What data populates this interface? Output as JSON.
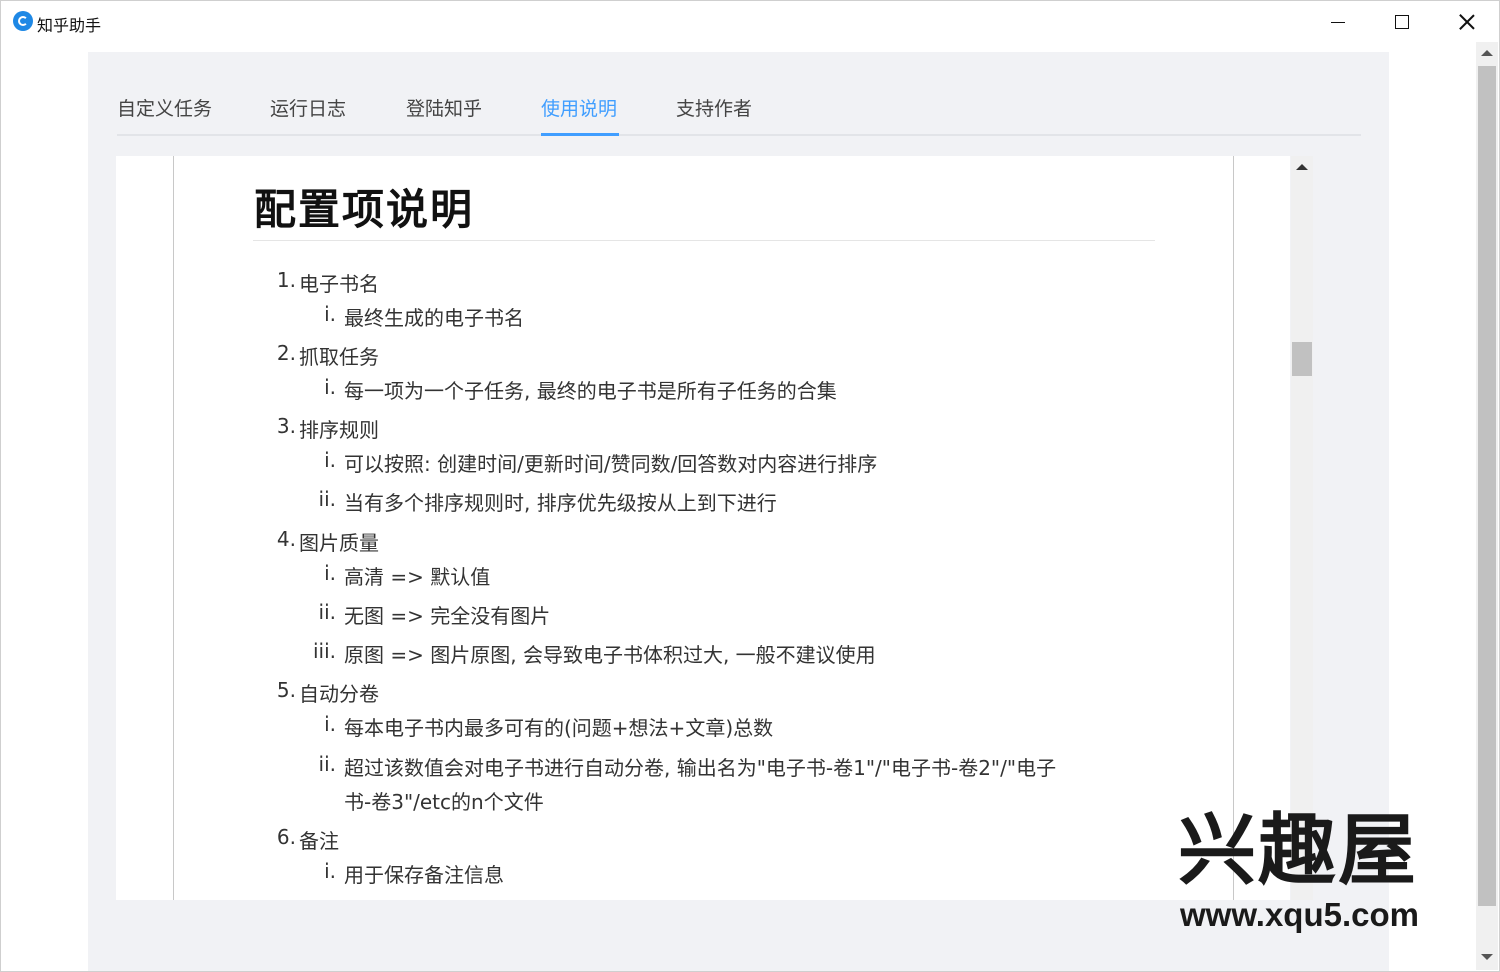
{
  "window": {
    "title": "知乎助手"
  },
  "tabs": [
    {
      "label": "自定义任务",
      "active": false
    },
    {
      "label": "运行日志",
      "active": false
    },
    {
      "label": "登陆知乎",
      "active": false
    },
    {
      "label": "使用说明",
      "active": true
    },
    {
      "label": "支持作者",
      "active": false
    }
  ],
  "colors": {
    "accent": "#409eff",
    "panel_bg": "#f1f2f5"
  },
  "doc": {
    "title": "配置项说明",
    "items": [
      {
        "num": "1.",
        "label": "电子书名",
        "subs": [
          {
            "num": "i.",
            "text": "最终生成的电子书名"
          }
        ]
      },
      {
        "num": "2.",
        "label": "抓取任务",
        "subs": [
          {
            "num": "i.",
            "text": "每一项为一个子任务, 最终的电子书是所有子任务的合集"
          }
        ]
      },
      {
        "num": "3.",
        "label": "排序规则",
        "subs": [
          {
            "num": "i.",
            "text": "可以按照: 创建时间/更新时间/赞同数/回答数对内容进行排序"
          },
          {
            "num": "ii.",
            "text": "当有多个排序规则时, 排序优先级按从上到下进行"
          }
        ]
      },
      {
        "num": "4.",
        "label": "图片质量",
        "subs": [
          {
            "num": "i.",
            "text": "高清 => 默认值"
          },
          {
            "num": "ii.",
            "text": "无图 => 完全没有图片"
          },
          {
            "num": "iii.",
            "text": "原图 => 图片原图, 会导致电子书体积过大, 一般不建议使用"
          }
        ]
      },
      {
        "num": "5.",
        "label": "自动分卷",
        "subs": [
          {
            "num": "i.",
            "text": "每本电子书内最多可有的(问题+想法+文章)总数"
          },
          {
            "num": "ii.",
            "text": "超过该数值会对电子书进行自动分卷, 输出名为\"电子书-卷1\"/\"电子书-卷2\"/\"电子",
            "cont": "书-卷3\"/etc的n个文件"
          }
        ]
      },
      {
        "num": "6.",
        "label": "备注",
        "subs": [
          {
            "num": "i.",
            "text": "用于保存备注信息"
          }
        ]
      }
    ]
  },
  "watermark": {
    "logo_text": "兴趣屋",
    "url": "www.xqu5.com"
  }
}
